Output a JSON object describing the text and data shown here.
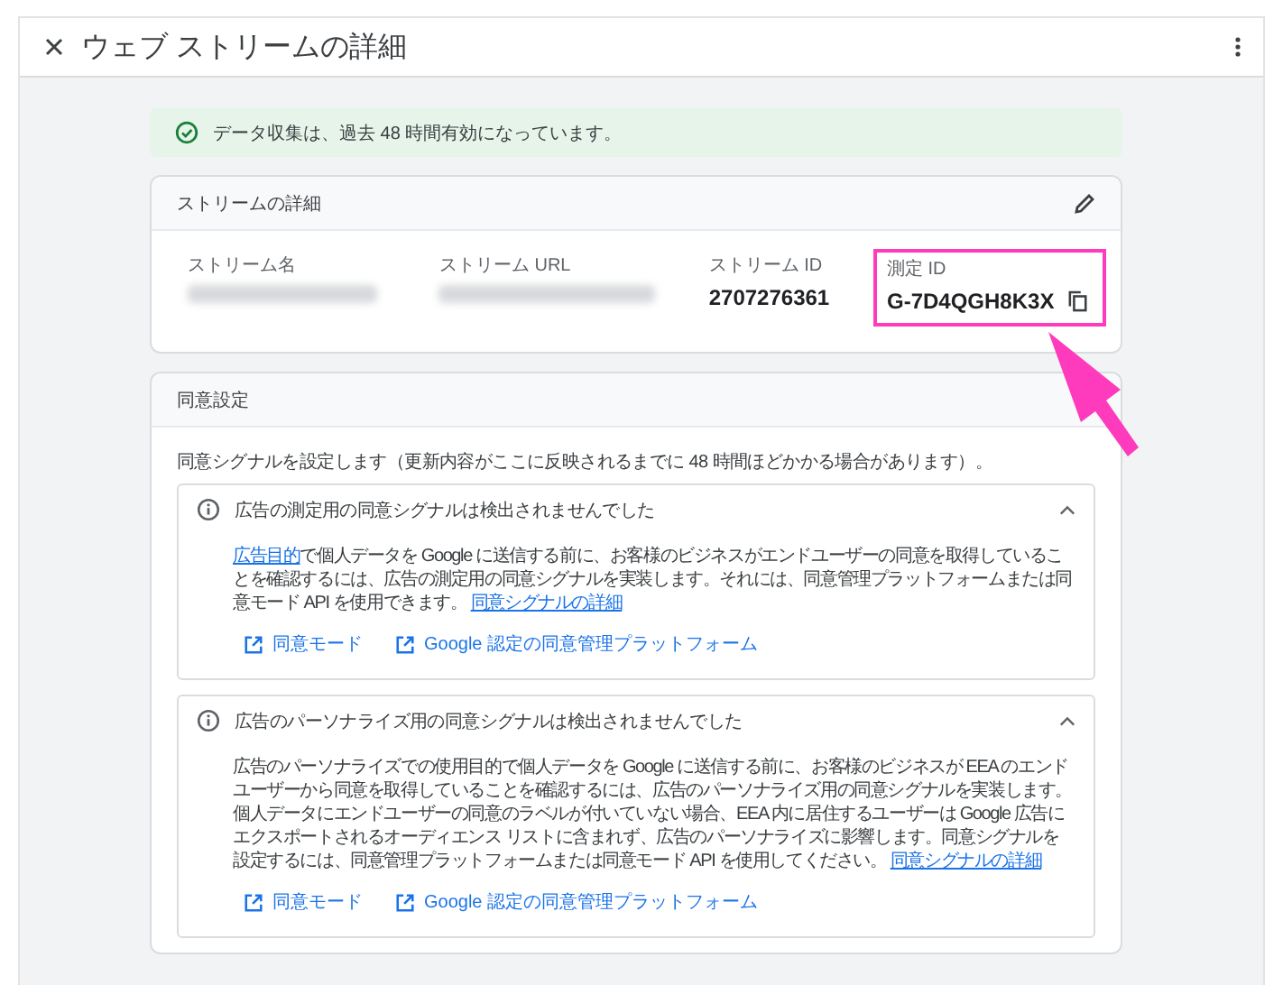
{
  "header": {
    "title": "ウェブ ストリームの詳細"
  },
  "banner": {
    "text": "データ収集は、過去 48 時間有効になっています。"
  },
  "stream_card": {
    "title": "ストリームの詳細",
    "fields": [
      {
        "label": "ストリーム名",
        "kind": "hidden",
        "highlighted": false
      },
      {
        "label": "ストリーム URL",
        "kind": "hidden",
        "highlighted": false
      },
      {
        "label": "ストリーム ID",
        "kind": "value",
        "value": "2707276361",
        "highlighted": false
      },
      {
        "label": "測定 ID",
        "kind": "copy",
        "value": "G-7D4QGH8K3X",
        "highlighted": true
      }
    ]
  },
  "consent_card": {
    "title": "同意設定",
    "intro": "同意シグナルを設定します（更新内容がここに反映されるまでに 48 時間ほどかかる場合があります）。",
    "sections": [
      {
        "title": "広告の測定用の同意シグナルは検出されませんでした",
        "expanded": true,
        "body": [
          {
            "kind": "link",
            "text": "広告目的"
          },
          {
            "kind": "text",
            "text": "で個人データを Google に送信する前に、お客様のビジネスがエンドユーザーの同意を取得していることを確認するには、広告の測定用の同意シグナルを実装します。それには、同意管理プラットフォームまたは同意モード API を使用できます。 "
          },
          {
            "kind": "link",
            "text": "同意シグナルの詳細"
          }
        ],
        "links": [
          "同意モード",
          "Google 認定の同意管理プラットフォーム"
        ]
      },
      {
        "title": "広告のパーソナライズ用の同意シグナルは検出されませんでした",
        "expanded": true,
        "body": [
          {
            "kind": "text",
            "text": "広告のパーソナライズでの使用目的で個人データを Google に送信する前に、お客様のビジネスが EEA のエンドユーザーから同意を取得していることを確認するには、広告のパーソナライズ用の同意シグナルを実装します。個人データにエンドユーザーの同意のラベルが付いていない場合、EEA 内に居住するユーザーは Google 広告にエクスポートされるオーディエンス リストに含まれず、広告のパーソナライズに影響します。同意シグナルを設定するには、同意管理プラットフォームまたは同意モード API を使用してください。 "
          },
          {
            "kind": "link",
            "text": "同意シグナルの詳細"
          }
        ],
        "links": [
          "同意モード",
          "Google 認定の同意管理プラットフォーム"
        ]
      }
    ]
  }
}
